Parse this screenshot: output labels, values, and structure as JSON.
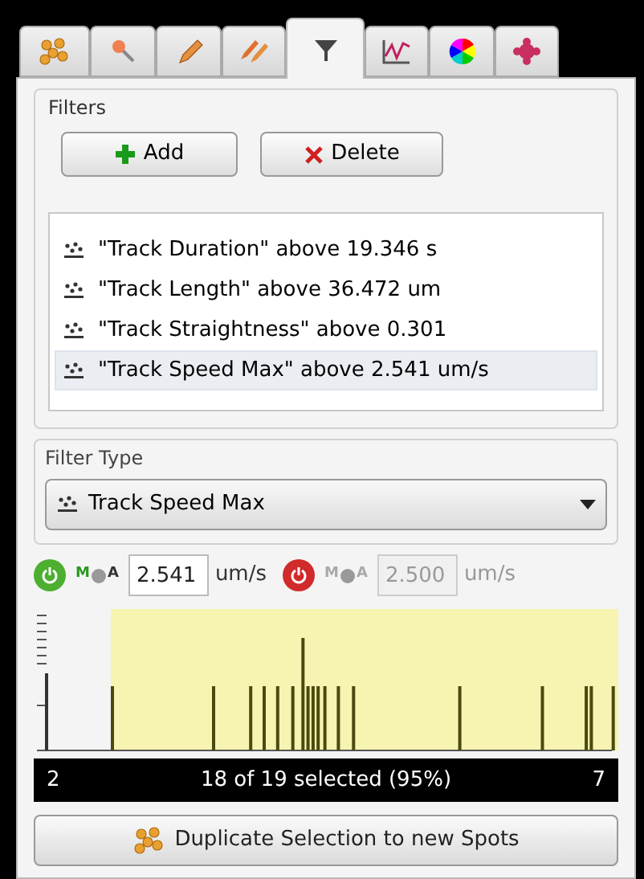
{
  "tabs": [
    {
      "selected": false
    },
    {
      "selected": false
    },
    {
      "selected": false
    },
    {
      "selected": false
    },
    {
      "selected": true
    },
    {
      "selected": false
    },
    {
      "selected": false
    },
    {
      "selected": false
    }
  ],
  "filters": {
    "title": "Filters",
    "add_button": "Add",
    "delete_button": "Delete",
    "items": [
      {
        "text": "\"Track Duration\" above 19.346 s",
        "selected": false
      },
      {
        "text": "\"Track Length\" above 36.472 um",
        "selected": false
      },
      {
        "text": "\"Track Straightness\" above 0.301",
        "selected": false
      },
      {
        "text": "\"Track Speed Max\" above 2.541 um/s",
        "selected": true
      }
    ]
  },
  "filter_type": {
    "title": "Filter Type",
    "value": "Track Speed Max"
  },
  "thresholds": [
    {
      "enabled": true,
      "auto_marks": [
        "M",
        "A"
      ],
      "value": "2.541",
      "unit": "um/s"
    },
    {
      "enabled": false,
      "auto_marks": [
        "M",
        "A"
      ],
      "value": "2.500",
      "unit": "um/s"
    }
  ],
  "histogram": {
    "min": "2",
    "summary": "18 of 19 selected (95%)",
    "max": "7"
  },
  "duplicate_button": "Duplicate Selection to new Spots"
}
